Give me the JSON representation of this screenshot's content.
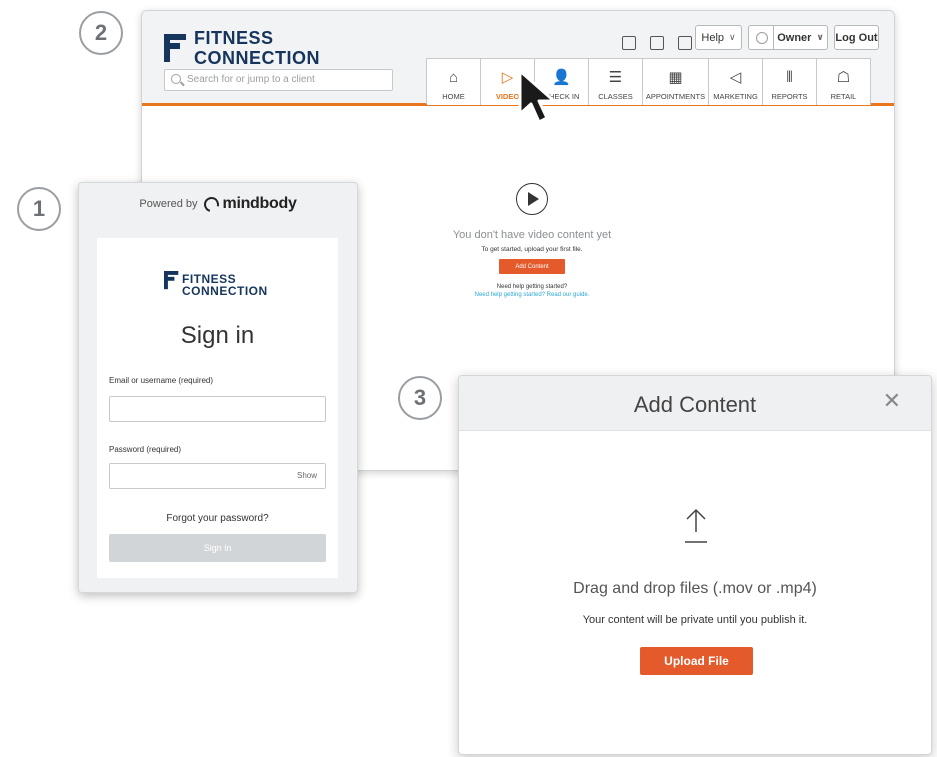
{
  "steps": {
    "one": "1",
    "two": "2",
    "three": "3"
  },
  "brand": {
    "line1": "FITNESS",
    "line2": "CONNECTION",
    "color": "#16355c"
  },
  "accent_color": "#e9751e",
  "dashboard": {
    "search_placeholder": "Search for or jump to a client",
    "help_label": "Help",
    "owner_label": "Owner",
    "logout_label": "Log Out",
    "nav": [
      {
        "label": "HOME",
        "icon": "home-icon",
        "active": false
      },
      {
        "label": "VIDEO",
        "icon": "video-icon",
        "active": true
      },
      {
        "label": "CHECK IN",
        "icon": "check-in-icon",
        "active": false
      },
      {
        "label": "CLASSES",
        "icon": "classes-icon",
        "active": false
      },
      {
        "label": "APPOINTMENTS",
        "icon": "appointments-icon",
        "active": false
      },
      {
        "label": "MARKETING",
        "icon": "marketing-icon",
        "active": false
      },
      {
        "label": "REPORTS",
        "icon": "reports-icon",
        "active": false
      },
      {
        "label": "RETAIL",
        "icon": "retail-icon",
        "active": false
      }
    ],
    "empty_title": "You don't have video content yet",
    "empty_sub": "To get started, upload your first file.",
    "add_content_label": "Add Content",
    "help_question": "Need help getting started?",
    "help_link": "Need help getting started? Read our guide."
  },
  "signin": {
    "powered_by": "Powered by",
    "provider": "mindbody",
    "title": "Sign in",
    "email_label": "Email or username (required)",
    "password_label": "Password (required)",
    "show_label": "Show",
    "forgot_label": "Forgot your password?",
    "submit_label": "Sign in"
  },
  "modal": {
    "title": "Add Content",
    "close_glyph": "✕",
    "drag_text": "Drag and drop files (.mov or .mp4)",
    "private_text": "Your content will be private until you publish it.",
    "upload_label": "Upload File",
    "button_color": "#e55a2b"
  }
}
